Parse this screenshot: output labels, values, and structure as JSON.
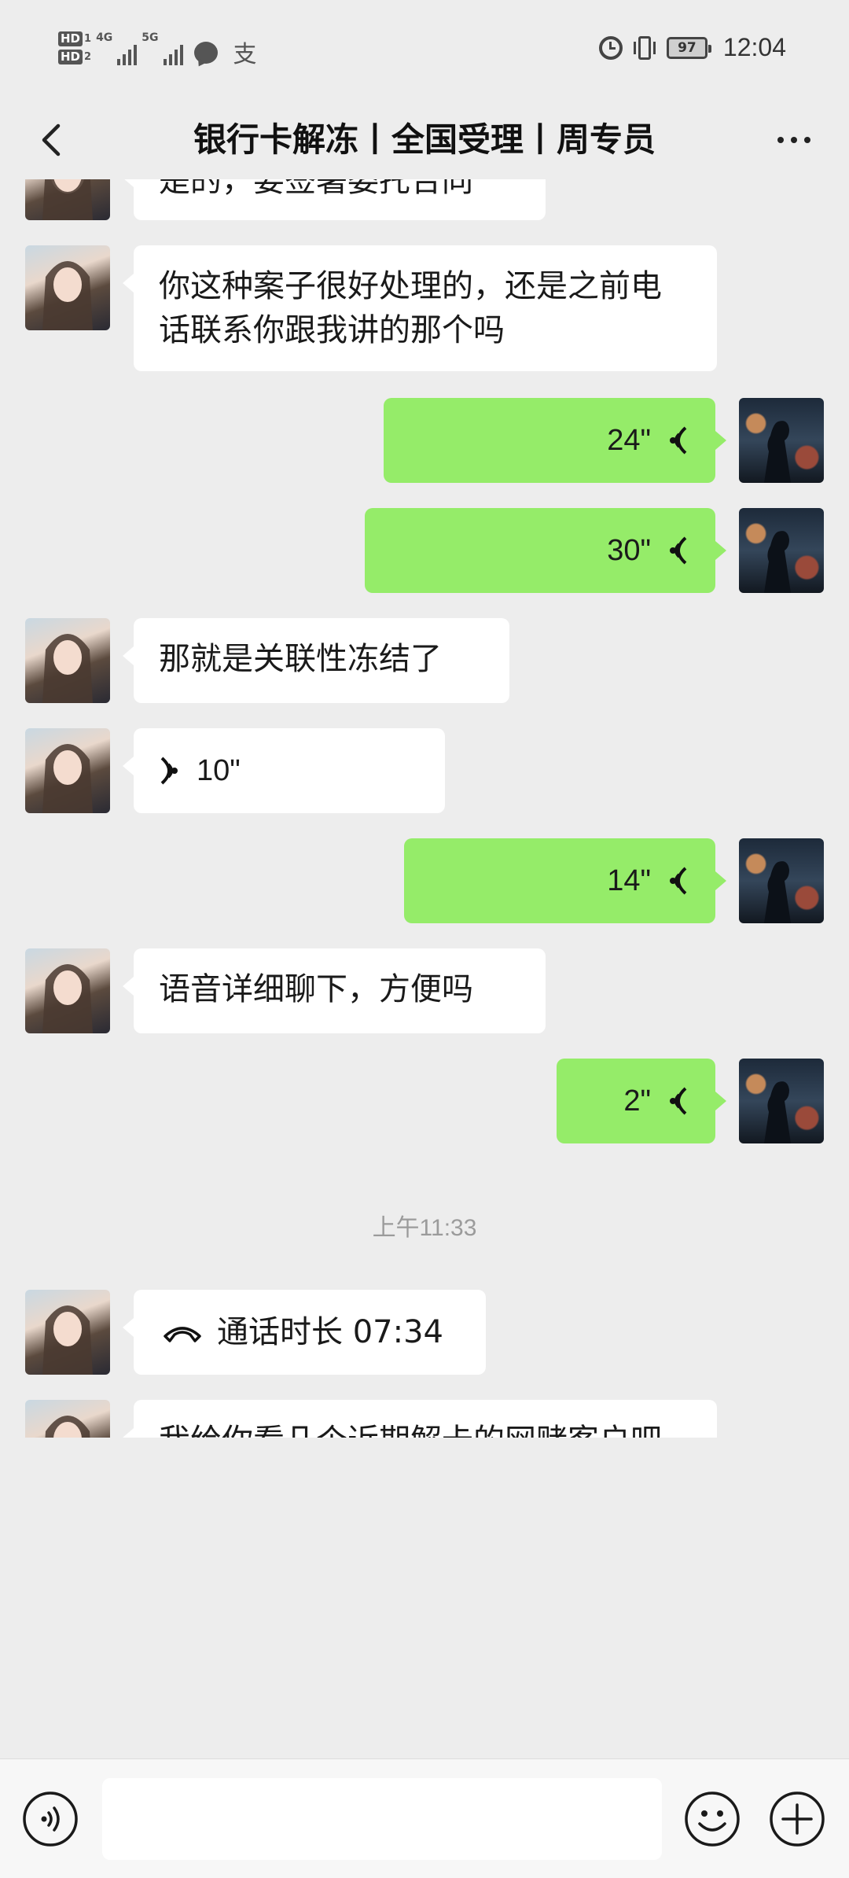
{
  "status_bar": {
    "hd1": "HD",
    "hd1_num": "1",
    "hd2": "HD",
    "hd2_num": "2",
    "net1": "4G",
    "net2": "5G",
    "alipay_glyph": "支",
    "battery": "97",
    "time": "12:04"
  },
  "header": {
    "title": "银行卡解冻丨全国受理丨周专员"
  },
  "messages": {
    "m0": "是的，要签署委托合同",
    "m1": "你这种案子很好处理的，还是之前电话联系你跟我讲的那个吗",
    "v1": "24\"",
    "v2": "30\"",
    "m2": "那就是关联性冻结了",
    "v3": "10\"",
    "v4": "14\"",
    "m3": "语音详细聊下，方便吗",
    "v5": "2\"",
    "timestamp": "上午11:33",
    "call": "通话时长 07:34",
    "m4": "我给你看几个近期解卡的网赌客户吧"
  },
  "input_bar": {
    "placeholder": ""
  },
  "icons": {
    "back": "chevron-left-icon",
    "more": "more-dots-icon",
    "voice": "voice-toggle-icon",
    "emoji": "emoji-icon",
    "plus": "plus-icon"
  },
  "colors": {
    "chat_bg": "#ededed",
    "my_bubble": "#95ec69",
    "their_bubble": "#ffffff"
  }
}
